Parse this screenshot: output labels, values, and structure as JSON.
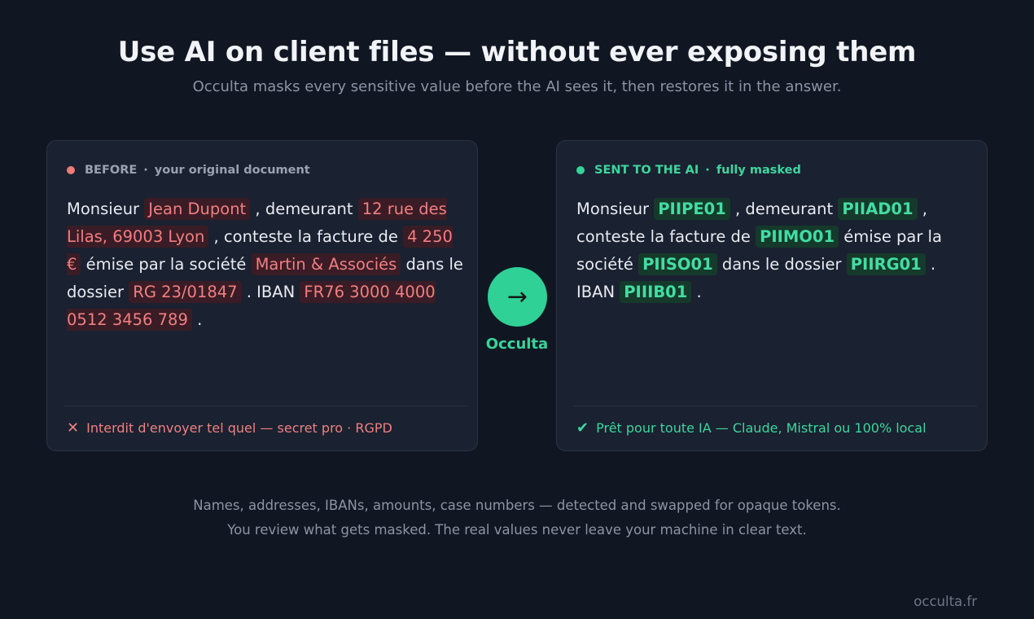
{
  "header": {
    "title": "Use AI on client files — without ever exposing them",
    "subtitle": "Occulta masks every sensitive value before the AI sees it, then restores it in the answer."
  },
  "before_card": {
    "label": "BEFORE",
    "separator": "·",
    "tag": "your original document",
    "text": {
      "t1": "Monsieur ",
      "name": "Jean Dupont",
      "t2": " , demeurant ",
      "address": "12 rue des Lilas, 69003 Lyon",
      "t3": " , conteste la facture de ",
      "amount": "4 250 €",
      "t4": " émise par la société ",
      "company": "Martin & Associés",
      "t5": " dans le dossier ",
      "case": "RG 23/01847",
      "t6": " . IBAN ",
      "iban": "FR76 3000 4000 0512 3456 789",
      "t7": " ."
    },
    "footer": "Interdit d'envoyer tel quel — secret pro · RGPD",
    "footer_icon": "cross-icon"
  },
  "after_card": {
    "label": "SENT TO THE AI",
    "separator": "·",
    "tag": "fully masked",
    "text": {
      "t1": "Monsieur ",
      "name": "PIIPE01",
      "t2": " , demeurant ",
      "address": "PIIAD01",
      "t3": " , conteste la facture de ",
      "amount": "PIIMO01",
      "t4": " émise par la société ",
      "company": "PIISO01",
      "t5": " dans le dossier ",
      "case": "PIIRG01",
      "t6": " . IBAN ",
      "iban": "PIIIB01",
      "t7": " ."
    },
    "footer": "Prêt pour toute IA — Claude, Mistral ou 100% local",
    "footer_icon": "checkmark-icon"
  },
  "center": {
    "arrow": "→",
    "label": "Occulta"
  },
  "footer": {
    "line1": "Names, addresses, IBANs, amounts, case numbers — detected and swapped for opaque tokens.",
    "line2": "You review what gets masked. The real values never leave your machine in clear text.",
    "brand": "occulta.fr"
  },
  "colors": {
    "background": "#111722",
    "card": "#1a2130",
    "danger": "#f07a7a",
    "accent": "#2fd196"
  }
}
